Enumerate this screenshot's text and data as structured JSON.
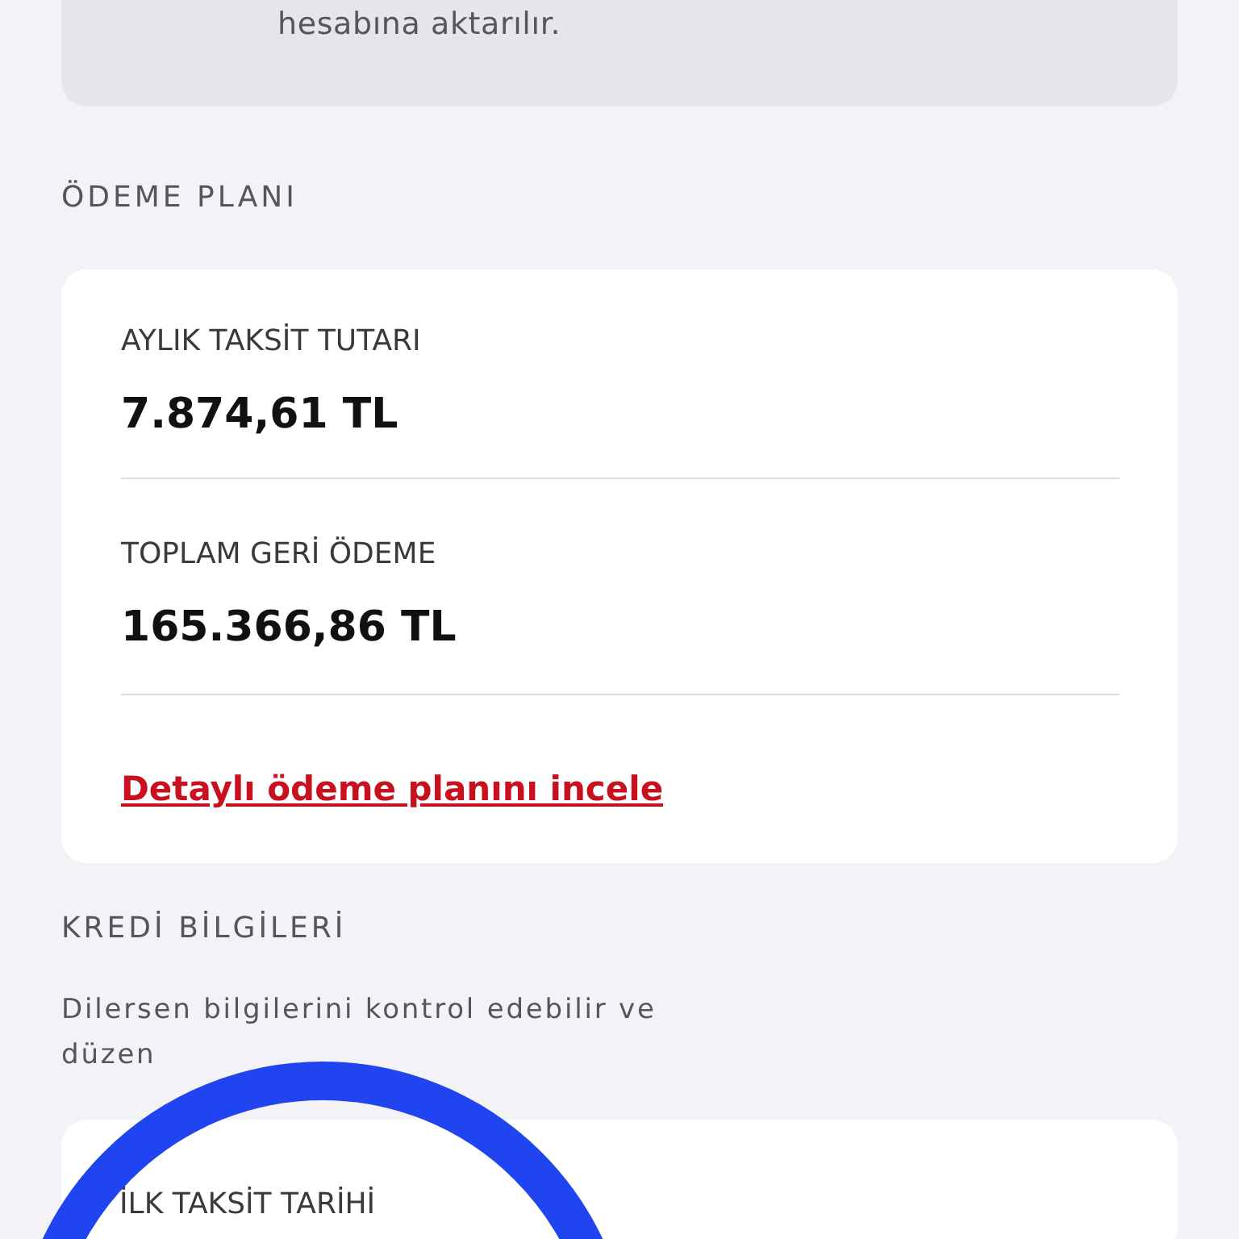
{
  "notice": {
    "text": "hesabına aktarılır."
  },
  "payment_plan": {
    "heading": "ÖDEME PLANI",
    "items": [
      {
        "label": "AYLIK TAKSİT TUTARI",
        "value": "7.874,61 TL"
      },
      {
        "label": "TOPLAM GERİ ÖDEME",
        "value": "165.366,86 TL"
      }
    ],
    "link": "Detaylı ödeme planını incele"
  },
  "credit_info": {
    "heading": "KREDİ BİLGİLERİ",
    "description": "Dilersen bilgilerini kontrol edebilir ve düzen",
    "items": [
      {
        "label": "İLK TAKSİT TARİHİ"
      }
    ]
  }
}
